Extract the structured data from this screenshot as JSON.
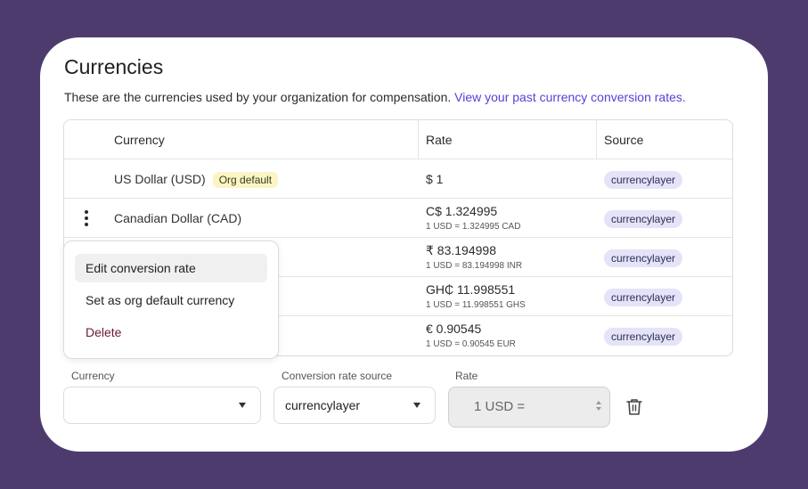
{
  "page": {
    "title": "Currencies",
    "subtitle": "These are the currencies used by your organization for compensation.",
    "subtitle_link": "View your past currency conversion rates."
  },
  "table": {
    "headers": {
      "currency": "Currency",
      "rate": "Rate",
      "source": "Source"
    },
    "rows": [
      {
        "currency": "US Dollar (USD)",
        "badge": "Org default",
        "rate": "$ 1",
        "rate_sub": "",
        "source": "currencylayer"
      },
      {
        "currency": "Canadian Dollar (CAD)",
        "rate": "C$ 1.324995",
        "rate_sub": "1 USD = 1.324995 CAD",
        "source": "currencylayer"
      },
      {
        "currency": "",
        "rate": "₹ 83.194998",
        "rate_sub": "1 USD = 83.194998 INR",
        "source": "currencylayer"
      },
      {
        "currency": "",
        "rate": "GH₵ 11.998551",
        "rate_sub": "1 USD = 11.998551 GHS",
        "source": "currencylayer"
      },
      {
        "currency": "",
        "rate": "€ 0.90545",
        "rate_sub": "1 USD = 0.90545 EUR",
        "source": "currencylayer"
      }
    ]
  },
  "context_menu": {
    "items": [
      {
        "label": "Edit conversion rate"
      },
      {
        "label": "Set as org default currency"
      },
      {
        "label": "Delete"
      }
    ]
  },
  "form": {
    "currency_label": "Currency",
    "currency_value": "",
    "source_label": "Conversion rate source",
    "source_value": "currencylayer",
    "rate_label": "Rate",
    "rate_value": "1 USD ="
  },
  "icons": {
    "kebab": "more-vertical-icon",
    "caret": "caret-down-icon",
    "trash": "trash-icon",
    "spinner": "number-spinner-icon"
  },
  "colors": {
    "background": "#4e3b6e",
    "link": "#5a3fd6",
    "default_badge": "#fbf5c6",
    "source_badge": "#e4e3f8",
    "delete": "#6a1a3a"
  }
}
